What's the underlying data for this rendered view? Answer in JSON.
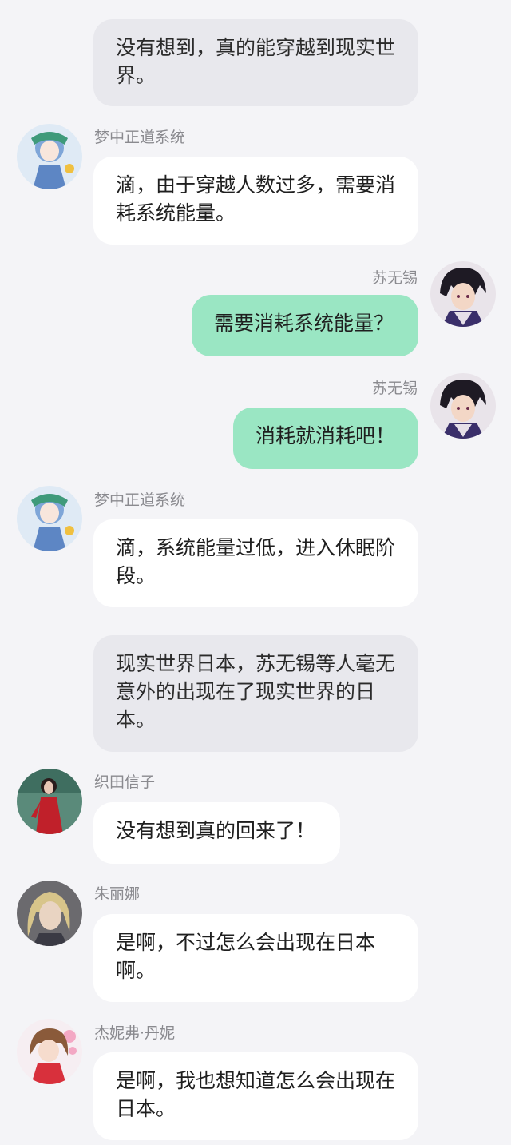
{
  "messages": {
    "m1": {
      "text": "没有想到，真的能穿越到现实世界。"
    },
    "m2": {
      "sender": "梦中正道系统",
      "avatar_icon": "anime-girl-teal-avatar-icon",
      "text": "滴，由于穿越人数过多，需要消耗系统能量。"
    },
    "m3": {
      "sender": "苏无锡",
      "avatar_icon": "anime-boy-dark-hair-avatar-icon",
      "text": "需要消耗系统能量？"
    },
    "m4": {
      "sender": "苏无锡",
      "avatar_icon": "anime-boy-dark-hair-avatar-icon",
      "text": "消耗就消耗吧！"
    },
    "m5": {
      "sender": "梦中正道系统",
      "avatar_icon": "anime-girl-teal-avatar-icon",
      "text": "滴，系统能量过低，进入休眠阶段。"
    },
    "m6": {
      "text": "现实世界日本，苏无锡等人毫无意外的出现在了现实世界的日本。"
    },
    "m7": {
      "sender": "织田信子",
      "avatar_icon": "woman-red-dress-avatar-icon",
      "text": "没有想到真的回来了！"
    },
    "m8": {
      "sender": "朱丽娜",
      "avatar_icon": "anime-blonde-woman-avatar-icon",
      "text": "是啊，不过怎么会出现在日本啊。"
    },
    "m9": {
      "sender": "杰妮弗·丹妮",
      "avatar_icon": "anime-girl-brown-hair-avatar-icon",
      "text": "是啊，我也想知道怎么会出现在日本。"
    }
  },
  "colors": {
    "background": "#f4f4f7",
    "narration_bubble": "#e8e8ed",
    "incoming_bubble": "#ffffff",
    "outgoing_bubble": "#9ae6c3",
    "sender_name": "#8a8a8f"
  }
}
